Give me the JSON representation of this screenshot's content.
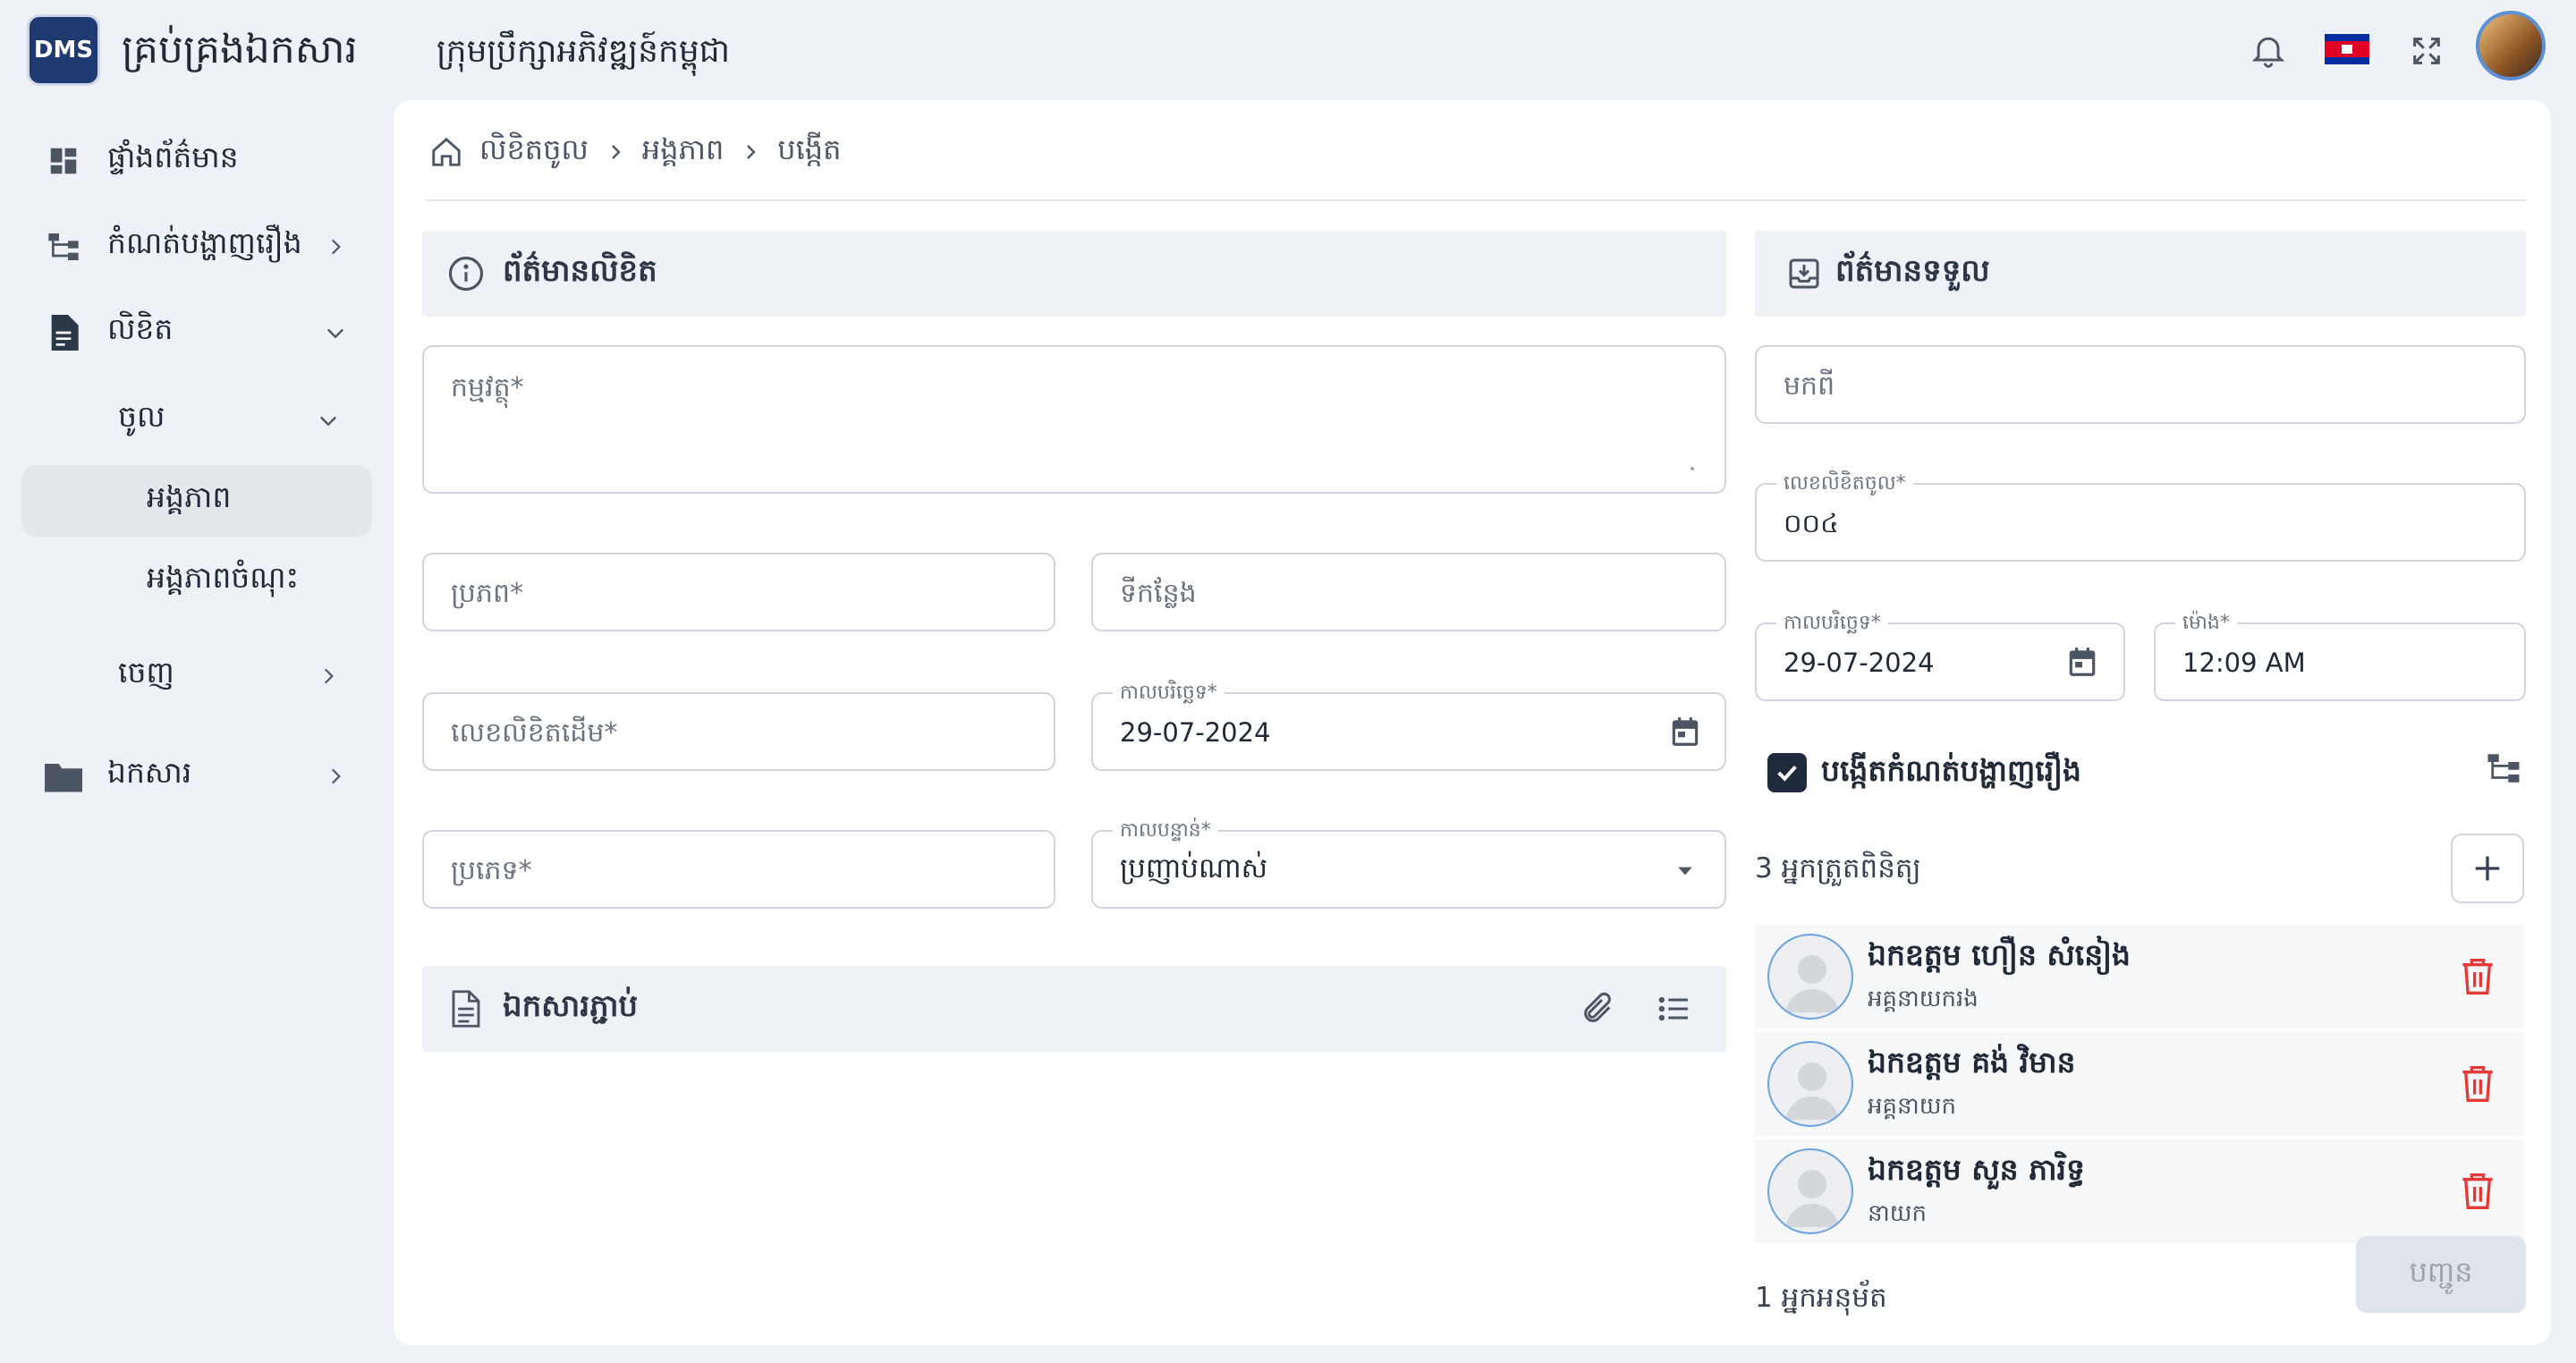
{
  "header": {
    "logo_text": "DMS",
    "app_title": "គ្រប់គ្រងឯកសារ",
    "org_title": "ក្រុមប្រឹក្សាអភិវឌ្ឍន៍កម្ពុជា",
    "icons": [
      "bell-icon",
      "cambodia-flag-icon",
      "fullscreen-icon",
      "user-avatar"
    ]
  },
  "sidebar": {
    "items": [
      {
        "label": "ផ្ទាំងព័ត៌មាន",
        "icon": "dashboard-icon"
      },
      {
        "label": "កំណត់បង្ហាញរឿង",
        "icon": "hierarchy-icon"
      },
      {
        "label": "លិខិត",
        "icon": "document-icon"
      },
      {
        "label": "ចូល"
      },
      {
        "label": "អង្គភាព"
      },
      {
        "label": "អង្គភាពចំណុះ"
      },
      {
        "label": "ចេញ"
      },
      {
        "label": "ឯកសារ",
        "icon": "folder-icon"
      }
    ]
  },
  "breadcrumb": {
    "items": [
      "លិខិតចូល",
      "អង្គភាព",
      "បង្កើត"
    ]
  },
  "doc_info": {
    "title": "ព័ត៌មានលិខិត",
    "subject_placeholder": "កម្មវត្ថុ*",
    "source_placeholder": "ប្រភព*",
    "location_placeholder": "ទីកន្លែង",
    "original_no_placeholder": "លេខលិខិតដើម*",
    "date_label": "កាលបរិច្ឆេទ*",
    "date_value": "29-07-2024",
    "type_placeholder": "ប្រភេទ*",
    "priority_label": "កាលបន្ទាន់*",
    "priority_value": "ប្រញាប់ណាស់"
  },
  "attachments": {
    "title": "ឯកសារភ្ជាប់"
  },
  "receive_info": {
    "title": "ព័ត៌មានទទួល",
    "from_placeholder": "មកពី",
    "incoming_no_label": "លេខលិខិតចូល*",
    "incoming_no_value": "០០៤",
    "date_label": "កាលបរិច្ឆេទ*",
    "date_value": "29-07-2024",
    "time_label": "ម៉ោង*",
    "time_value": "12:09 AM",
    "create_flow_label": "បង្កើតកំណត់បង្ហាញរឿង",
    "create_flow_checked": true
  },
  "reviewers": {
    "count_label": "3 អ្នកត្រួតពិនិត្យ",
    "list": [
      {
        "name": "ឯកឧត្តម ហឿន សំនៀង",
        "role": "អគ្គនាយករង"
      },
      {
        "name": "ឯកឧត្តម គង់ វិមាន",
        "role": "អគ្គនាយក"
      },
      {
        "name": "ឯកឧត្តម សួន ភារិទ្ធ",
        "role": "នាយក"
      }
    ]
  },
  "approvers": {
    "count_label": "1 អ្នកអនុម័ត"
  },
  "actions": {
    "submit_label": "បញ្ជូន"
  },
  "colors": {
    "accent": "#1f2a3d",
    "delete": "#e53935",
    "section_bg": "#eef1f5"
  }
}
